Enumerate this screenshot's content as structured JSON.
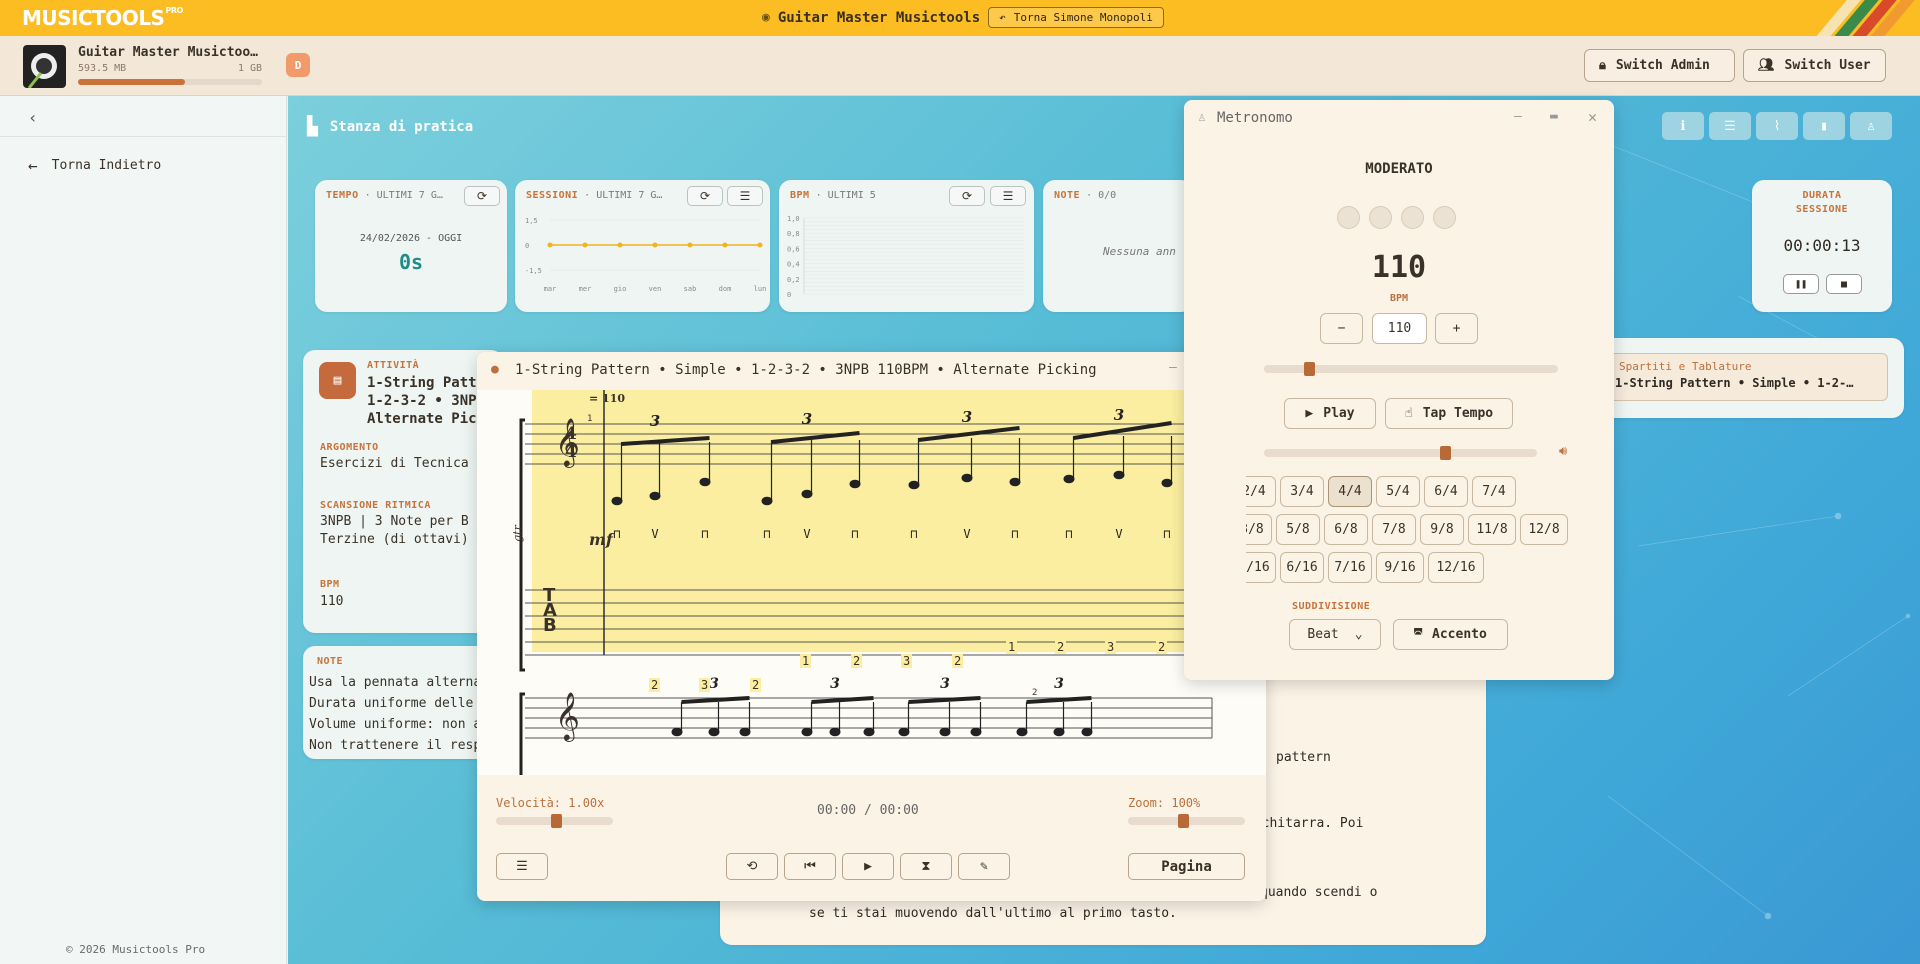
{
  "topbar": {
    "logo": "MUSICTOOLS",
    "logo_sup": "PRO",
    "title": "Guitar Master Musictools",
    "back_user": "Torna Simone Monopoli"
  },
  "device": {
    "name": "Guitar Master Musictoo…",
    "used": "593.5 MB",
    "total": "1 GB",
    "usage_fraction": 0.58,
    "badge": "D"
  },
  "buttons": {
    "switch_admin": "Switch Admin",
    "switch_user": "Switch User"
  },
  "sidebar": {
    "back": "Torna Indietro",
    "copyright": "© 2026 Musictools Pro"
  },
  "room": {
    "title": "Stanza di pratica"
  },
  "cards": {
    "tempo": {
      "label": "TEMPO",
      "range": "ULTIMI 7 G…",
      "dates": "24/02/2026 - OGGI",
      "value": "0s"
    },
    "sessioni": {
      "label": "SESSIONI",
      "range": "ULTIMI 7 G…"
    },
    "bpm": {
      "label": "BPM",
      "range": "ULTIMI 5"
    },
    "note": {
      "label": "NOTE",
      "count": "0/0",
      "empty": "Nessuna ann"
    },
    "durata": {
      "label1": "DURATA",
      "label2": "SESSIONE",
      "value": "00:00:13"
    }
  },
  "chart_data": [
    {
      "type": "line",
      "title": "SESSIONI",
      "categories": [
        "mar",
        "mer",
        "gio",
        "ven",
        "sab",
        "dom",
        "lun"
      ],
      "values": [
        0,
        0,
        0,
        0,
        0,
        0,
        0
      ],
      "y_ticks": [
        "1,5",
        "0",
        "-1,5"
      ],
      "ylim": [
        -1.5,
        1.5
      ],
      "color": "#f3b21f"
    },
    {
      "type": "line",
      "title": "BPM",
      "y_ticks": [
        "1,0",
        "0,8",
        "0,6",
        "0,4",
        "0,2",
        "0"
      ],
      "ylim": [
        0,
        1
      ],
      "values": []
    }
  ],
  "activity": {
    "label": "ATTIVITÀ",
    "title_lines": [
      "1-String Patt",
      "1-2-3-2 • 3NP",
      "Alternate Pic"
    ],
    "argomento_label": "ARGOMENTO",
    "argomento": "Esercizi di Tecnica",
    "scansione_label": "SCANSIONE RITMICA",
    "scansione_lines": [
      "3NPB | 3 Note per B",
      "Terzine (di ottavi)"
    ],
    "bpm_label": "BPM",
    "bpm": "110"
  },
  "notes": {
    "label": "NOTE",
    "lines": [
      "Usa la pennata alterna",
      "Durata uniforme delle",
      "Volume uniforme: non a",
      "Non trattenere il resp"
    ]
  },
  "bottom_text": {
    "line1": "pattern",
    "line2": "a chitarra. Poi",
    "line3": "quando scendi o",
    "line4": "se ti stai muovendo dall'ultimo al primo tasto."
  },
  "score": {
    "title": "1-String Pattern • Simple • 1-2-3-2 • 3NPB 110BPM • Alternate Picking",
    "tempo_mark": "= 110",
    "measure1": "1",
    "measure2": "2",
    "instrument": "gtr",
    "dynamic": "mf",
    "triplet": "3",
    "tab_numbers": [
      "2",
      "3",
      "2",
      "1",
      "2",
      "3",
      "2",
      "1",
      "2",
      "3",
      "2"
    ],
    "speed_label": "Velocità: 1.00x",
    "speed_value": 1.0,
    "time": "00:00 / 00:00",
    "zoom_label": "Zoom: 100%",
    "zoom_value": 1.0,
    "page_btn": "Pagina"
  },
  "metronome": {
    "title": "Metronomo",
    "tempo_name": "MODERATO",
    "bpm": "110",
    "bpm_label": "BPM",
    "bpm_input": "110",
    "minus": "−",
    "plus": "+",
    "play": "Play",
    "tap": "Tap Tempo",
    "signatures_row1": [
      "2/4",
      "3/4",
      "4/4",
      "5/4",
      "6/4",
      "7/4"
    ],
    "signatures_row2": [
      "3/8",
      "5/8",
      "6/8",
      "7/8",
      "9/8",
      "11/8",
      "12/8"
    ],
    "signatures_row3": [
      "3/16",
      "6/16",
      "7/16",
      "9/16",
      "12/16"
    ],
    "selected": "4/4",
    "sub_label": "SUDDIVISIONE",
    "sub_value": "Beat",
    "accent": "Accento"
  },
  "sheets": {
    "label": "Spartiti e Tablature",
    "item": "1-String Pattern • Simple • 1-2-…"
  }
}
